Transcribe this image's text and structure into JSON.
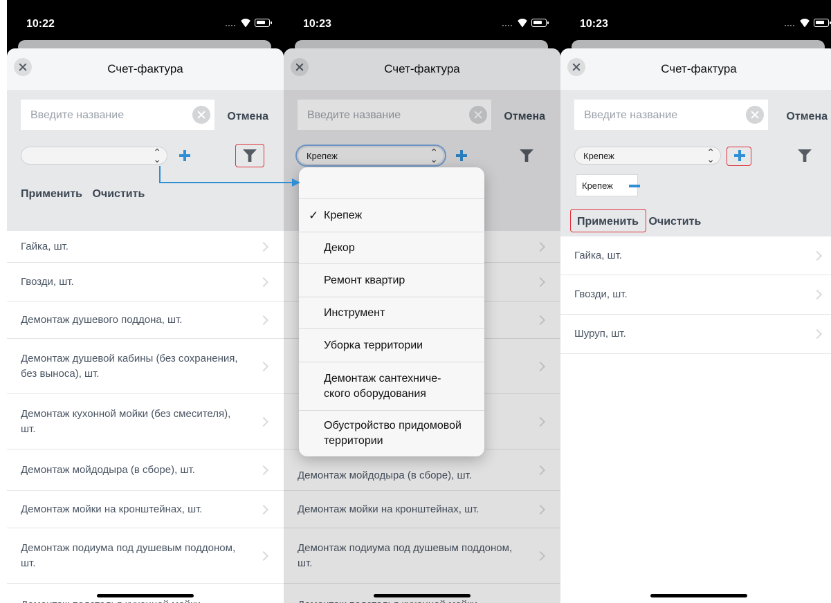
{
  "screens": [
    {
      "time": "10:22",
      "title": "Счет-фактура",
      "search": {
        "placeholder": "Введите название",
        "cancel": "Отмена"
      },
      "select_value": "",
      "actions": {
        "apply": "Применить",
        "clear": "Очистить"
      },
      "items": [
        "Гайка, шт.",
        "Гвозди, шт.",
        "Демонтаж душевого поддона, шт.",
        "Демонтаж душевой кабины (без сохранения, без выноса), шт.",
        "Демонтаж кухонной мойки (без смесителя), шт.",
        "Демонтаж мойдодыра (в сборе), шт.",
        "Демонтаж мойки на кронштейнах, шт.",
        "Демонтаж подиума под душевым поддоном, шт.",
        "Демонтаж подстолья кухонной мойки,"
      ]
    },
    {
      "time": "10:23",
      "title": "Счет-фактура",
      "search": {
        "placeholder": "Введите название",
        "cancel": "Отмена"
      },
      "select_value": "Крепеж",
      "visible_rows": [
        "Демонтаж мойдодыра (в сборе), шт.",
        "Демонтаж мойки на кронштейнах, шт.",
        "Демонтаж подиума под душевым поддоном, шт.",
        "Демонтаж подстолья кухонной мойки,"
      ],
      "dropdown": {
        "checkmark": "✓",
        "options": [
          "Крепеж",
          "Декор",
          "Ремонт квартир",
          "Инструмент",
          "Уборка территории",
          "Демонтаж сантехниче-ского оборудования",
          "Обустройство придомовой территории"
        ],
        "selected_index": 0
      }
    },
    {
      "time": "10:23",
      "title": "Счет-фактура",
      "search": {
        "placeholder": "Введите название",
        "cancel": "Отмена"
      },
      "select_value": "Крепеж",
      "tag": "Крепеж",
      "actions": {
        "apply": "Применить",
        "clear": "Очистить"
      },
      "items": [
        "Гайка, шт.",
        "Гвозди, шт.",
        "Шуруп, шт."
      ]
    }
  ],
  "colors": {
    "accent": "#2f8fd6",
    "highlight": "#e0313b",
    "toolbar": "#e7e8ea"
  }
}
